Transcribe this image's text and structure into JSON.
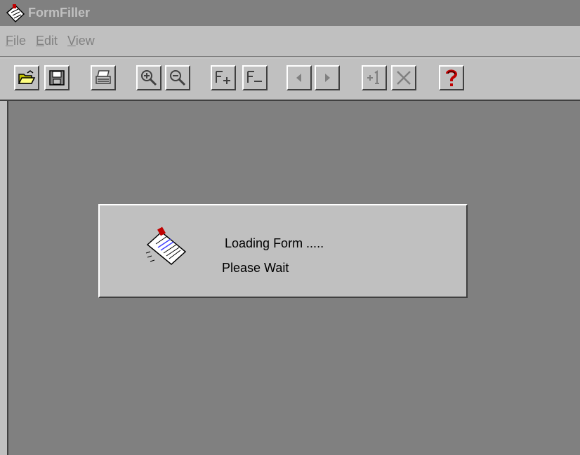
{
  "window": {
    "title": "FormFiller",
    "icon": "formfiller-app-icon"
  },
  "menu": {
    "items": [
      {
        "label": "File",
        "underline": "F",
        "rest": "ile"
      },
      {
        "label": "Edit",
        "underline": "E",
        "rest": "dit"
      },
      {
        "label": "View",
        "underline": "V",
        "rest": "iew"
      }
    ]
  },
  "toolbar": {
    "buttons": [
      {
        "icon": "open-folder-icon"
      },
      {
        "icon": "save-disk-icon"
      },
      {
        "icon": "print-icon"
      },
      {
        "icon": "zoom-in-icon"
      },
      {
        "icon": "zoom-out-icon"
      },
      {
        "icon": "field-add-icon"
      },
      {
        "icon": "field-remove-icon"
      },
      {
        "icon": "previous-arrow-icon"
      },
      {
        "icon": "next-arrow-icon"
      },
      {
        "icon": "add-page-icon"
      },
      {
        "icon": "delete-x-icon"
      },
      {
        "icon": "help-question-icon"
      }
    ]
  },
  "dialog": {
    "line1": "Loading Form .....",
    "line2": "Please Wait",
    "icon": "form-document-icon"
  },
  "colors": {
    "face": "#c0c0c0",
    "background": "#808080",
    "shadow": "#404040",
    "highlight": "#ffffff",
    "help_red": "#c00000",
    "folder_yellow": "#c0c000"
  }
}
